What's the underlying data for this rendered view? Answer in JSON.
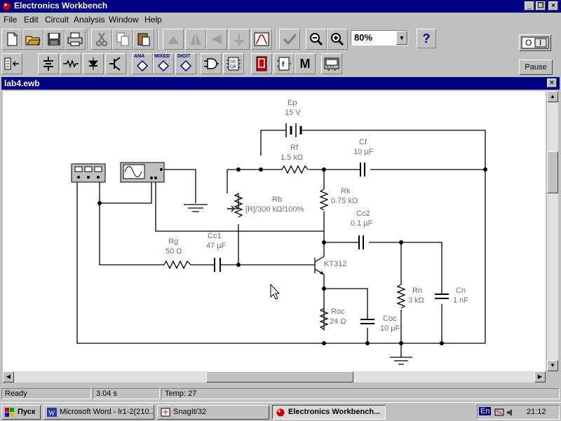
{
  "app": {
    "title": "Electronics Workbench"
  },
  "menu": [
    "File",
    "Edit",
    "Circuit",
    "Analysis",
    "Window",
    "Help"
  ],
  "toolbar1": {
    "buttons": [
      "new-icon",
      "open-icon",
      "save-icon",
      "print-icon",
      "cut-icon",
      "copy-icon",
      "paste-icon",
      "rotate-icon",
      "flip-horizontal-icon",
      "flip-vertical-icon",
      "subcircuit-icon",
      "graph-icon",
      "component-properties-icon",
      "zoom-out-icon",
      "zoom-in-icon"
    ],
    "zoom_value": "80%",
    "help_label": "?"
  },
  "toolbar2": {
    "buttons": [
      "parts-bin-icon",
      "sources-icon",
      "basic-icon",
      "diodes-icon",
      "transistors-icon",
      "analog-ics-icon",
      "mixed-ics-icon",
      "digital-ics-icon",
      "logic-gates-icon",
      "digital-icon",
      "indicators-icon",
      "controls-icon",
      "miscellaneous-icon",
      "instruments-icon"
    ],
    "ana_label": "ANA",
    "mixed_label": "MIXED",
    "digit_label": "DIGIT",
    "m_label": "M"
  },
  "controls": {
    "power_on": "I",
    "power_off": "O",
    "pause_label": "Pause"
  },
  "document": {
    "title": "lab4.ewb",
    "close_label": "×"
  },
  "circuit": {
    "ep_name": "Ep",
    "ep_value": "15 V",
    "rf_name": "Rf",
    "rf_value": "1.5 kΩ",
    "cf_name": "Cf",
    "cf_value": "10 µF",
    "rk_name": "Rk",
    "rk_value": "0.75 kΩ",
    "rb_name": "Rb",
    "rb_value": "[R]/300 kΩ/100%",
    "cc2_name": "Cc2",
    "cc2_value": "0.1 µF",
    "rg_name": "Rg",
    "rg_value": "50 Ω",
    "cc1_name": "Cc1",
    "cc1_value": "47 µF",
    "q_name": "KT312",
    "rn_name": "Rn",
    "rn_value": "3 kΩ",
    "cn_name": "Cn",
    "cn_value": "1 nF",
    "roc_name": "Roc",
    "roc_value": "24 Ω",
    "coc_name": "Coc",
    "coc_value": "10 µF"
  },
  "status": {
    "state": "Ready",
    "time": "3.04 s",
    "temp": "Temp:  27"
  },
  "taskbar": {
    "start_label": "Пуск",
    "tasks": [
      "Microsoft Word - lr1-2(210...",
      "SnagIt/32",
      "Electronics Workbench..."
    ],
    "lang": "En",
    "clock": "21:12"
  }
}
